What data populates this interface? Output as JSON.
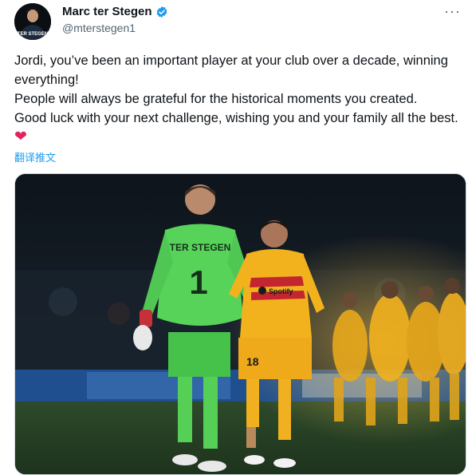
{
  "author": {
    "display_name": "Marc ter Stegen",
    "handle": "@mterstegen1",
    "avatar_text": "TER STEGEN"
  },
  "menu": {
    "more_glyph": "···"
  },
  "tweet": {
    "lines": [
      "Jordi, you’ve been an important player at your club over a decade, winning everything!",
      "People will always be grateful for the historical moments you created.",
      "Good luck with your next challenge, wishing you and your family all the best."
    ],
    "emoji": "❤"
  },
  "translate_label": "翻译推文",
  "photo": {
    "jersey_name": "TER STEGEN",
    "jersey_number": "1",
    "sponsor": "Spotify",
    "short_number": "18"
  },
  "colors": {
    "link": "#1d9bf0",
    "heart": "#e0245e",
    "gk_green": "#58d35a",
    "barca_yellow": "#f2b21e"
  }
}
